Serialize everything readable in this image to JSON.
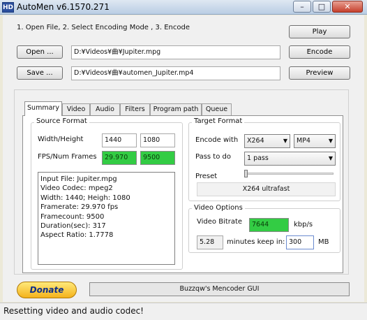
{
  "window": {
    "app_icon": "HD",
    "title": "AutoMen v6.1570.271",
    "minimize": "–",
    "maximize": "□",
    "close": "✕"
  },
  "instructions": "1. Open File, 2. Select Encoding Mode , 3. Encode",
  "buttons": {
    "play": "Play",
    "open": "Open ...",
    "encode": "Encode",
    "save": "Save ...",
    "preview": "Preview"
  },
  "paths": {
    "input": "D:¥Videos¥曲¥Jupiter.mpg",
    "output": "D:¥Videos¥曲¥automen_Jupiter.mp4"
  },
  "tabs": [
    "Summary",
    "Video",
    "Audio",
    "Filters",
    "Program path",
    "Queue"
  ],
  "source_format": {
    "title": "Source Format",
    "wh_label": "Width/Height",
    "width": "1440",
    "height": "1080",
    "fps_label": "FPS/Num Frames",
    "fps": "29.970",
    "num_frames": "9500",
    "info": [
      "Input File: Jupiter.mpg",
      "Video Codec: mpeg2",
      "Width: 1440; Heigh: 1080",
      "Framerate: 29.970 fps",
      "Framecount: 9500",
      "Duration(sec): 317",
      "Aspect Ratio: 1.7778"
    ]
  },
  "target_format": {
    "title": "Target Format",
    "encode_with_label": "Encode with",
    "encoder": "X264",
    "container": "MP4",
    "pass_label": "Pass to do",
    "pass": "1 pass",
    "preset_label": "Preset",
    "preset_value": "X264 ultrafast"
  },
  "video_options": {
    "title": "Video Options",
    "bitrate_label": "Video Bitrate",
    "bitrate": "7644",
    "bitrate_unit": "kbp/s",
    "minutes": "5.28",
    "keep_label": "minutes keep in:",
    "size": "300",
    "size_unit": "MB"
  },
  "donate": "Donate",
  "about": "Buzzqw's Mencoder GUI",
  "status": "Resetting video and audio codec!"
}
